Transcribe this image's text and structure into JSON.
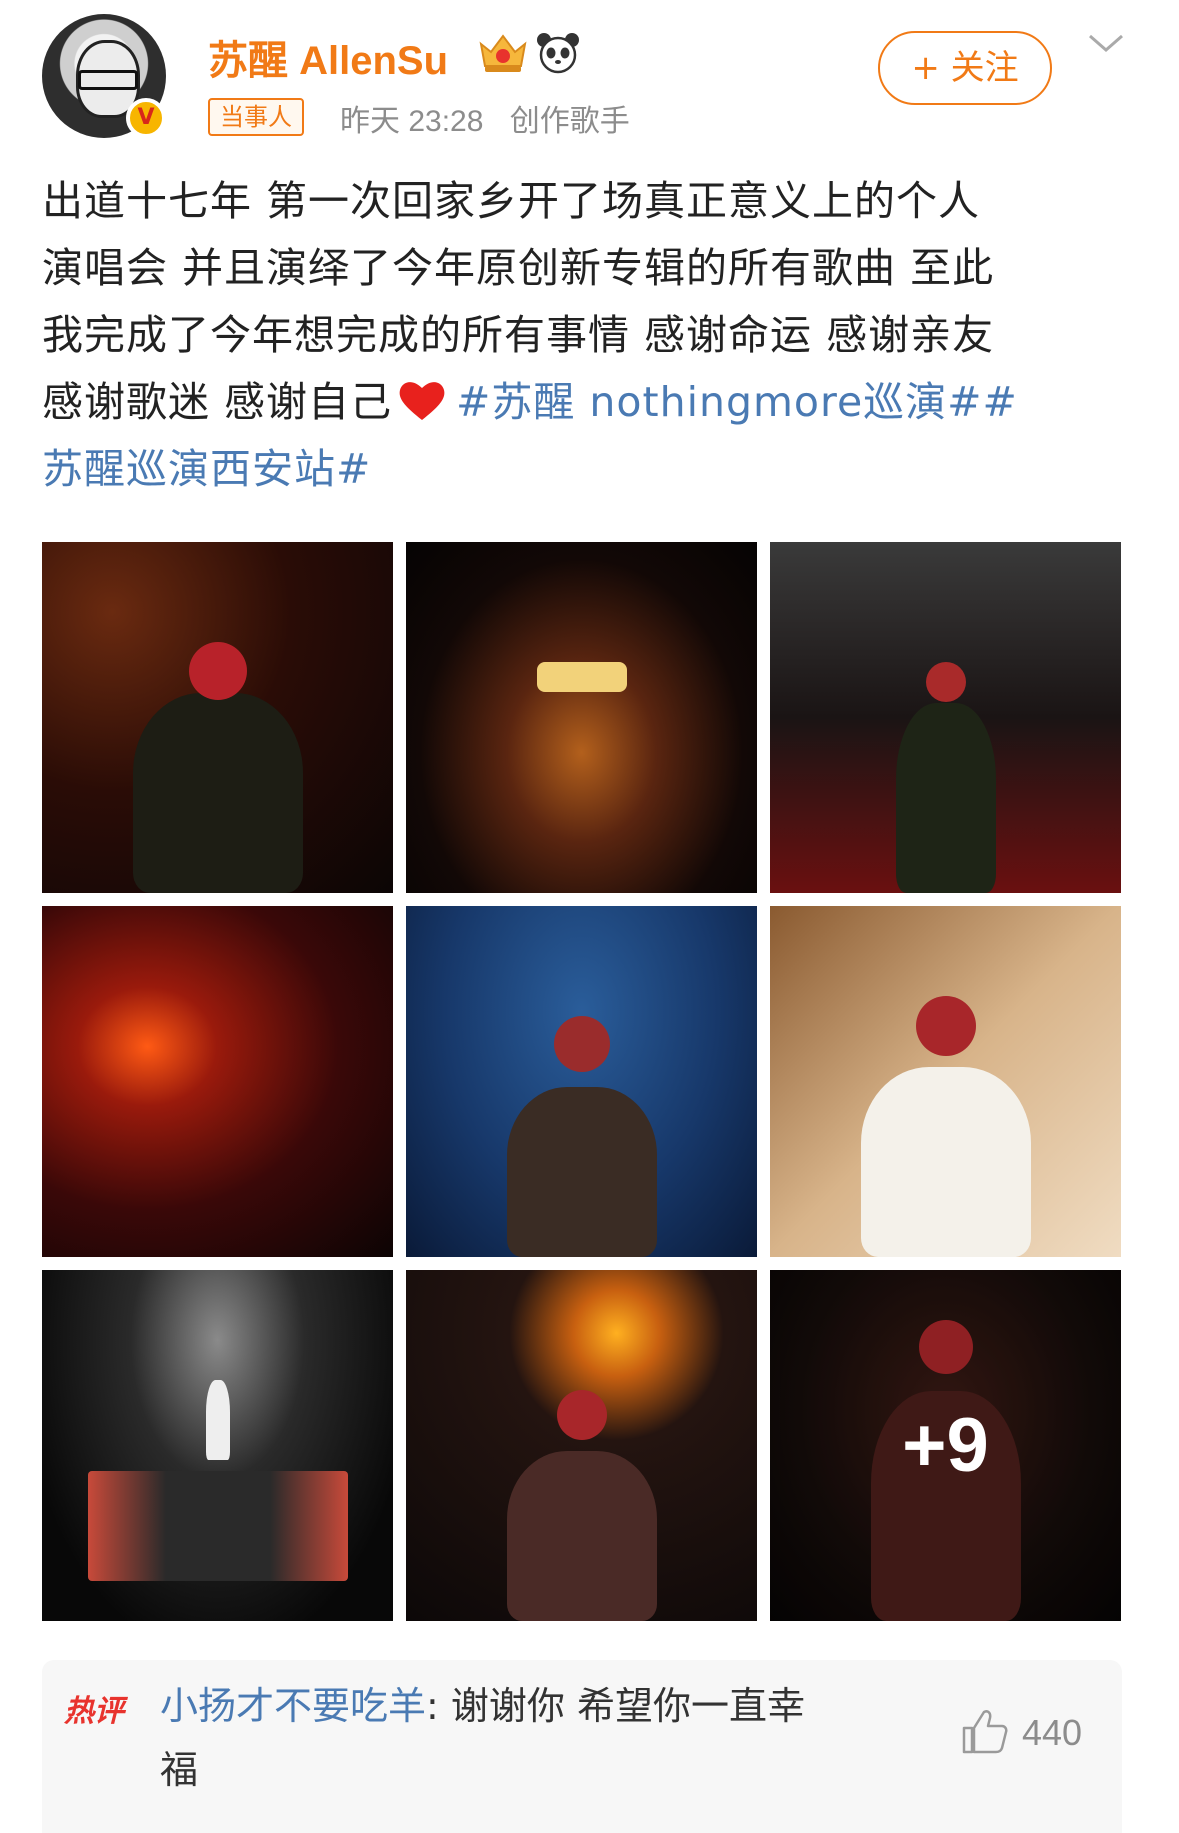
{
  "post": {
    "author": {
      "name": "苏醒 AllenSu",
      "avatar_icon": "avatar-portrait",
      "verified_badge": "V",
      "badge_icons": [
        "crown-badge-icon",
        "panda-icon"
      ]
    },
    "tag": "当事人",
    "time": "昨天 23:28",
    "source": "创作歌手",
    "follow_label": "+ 关注",
    "text": {
      "line1": "出道十七年 第一次回家乡开了场真正意义上的个人",
      "line2": "演唱会 并且演绎了今年原创新专辑的所有歌曲 至此",
      "line3": "我完成了今年想完成的所有事情 感谢命运 感谢亲友",
      "line4_plain": "感谢歌迷 感谢自己",
      "hashtag1": "#苏醒 nothingmore巡演#",
      "hashtag2_part1": "#",
      "hashtag2_part2": "苏醒巡演西安站#"
    },
    "photos": {
      "count_visible": 9,
      "more_label": "+9"
    }
  },
  "hot_comment": {
    "label": "热评",
    "user": "小扬才不要吃羊",
    "separator": ": ",
    "text_line1": "谢谢你 希望你一直幸",
    "text_line2": "福",
    "likes": "440"
  },
  "colors": {
    "accent_orange": "#f17a16",
    "link_blue": "#4a7ab3",
    "hot_red": "#e8332d",
    "meta_gray": "#8c8c8c"
  }
}
